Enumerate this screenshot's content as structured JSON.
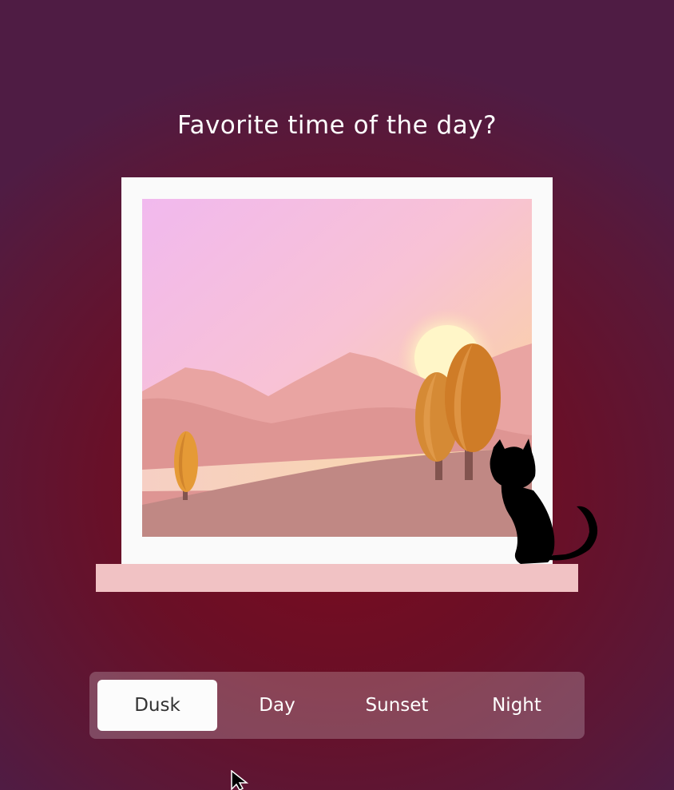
{
  "question": "Favorite time of the day?",
  "options": [
    {
      "label": "Dusk",
      "selected": true
    },
    {
      "label": "Day",
      "selected": false
    },
    {
      "label": "Sunset",
      "selected": false
    },
    {
      "label": "Night",
      "selected": false
    }
  ],
  "colors": {
    "background": "#6a0f26",
    "window_frame": "#fafafa",
    "sill": "#f1c2c4",
    "sun": "#fff6c8",
    "tree": "#d1822d",
    "cat": "#000000"
  },
  "icons": [
    "cat-icon",
    "sun-icon",
    "tree-icon",
    "mouse-cursor-icon"
  ]
}
